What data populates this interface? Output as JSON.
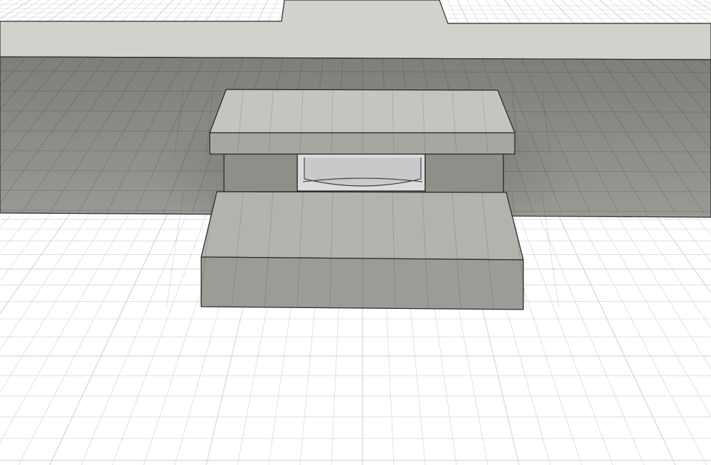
{
  "viewport": {
    "colors": {
      "background": "#ffffff",
      "grid": "#d6d6d6",
      "ground_band": "#d3d1cb",
      "wall": "#8b8a86",
      "slab_top": "#c6c4be",
      "slab_front": "#a8a6a0",
      "leg": "#908e89",
      "opening": "#dcdcdc",
      "step_top": "#b4b2ac",
      "step_front": "#9d9b96",
      "edge": "#2a2a2a"
    }
  }
}
